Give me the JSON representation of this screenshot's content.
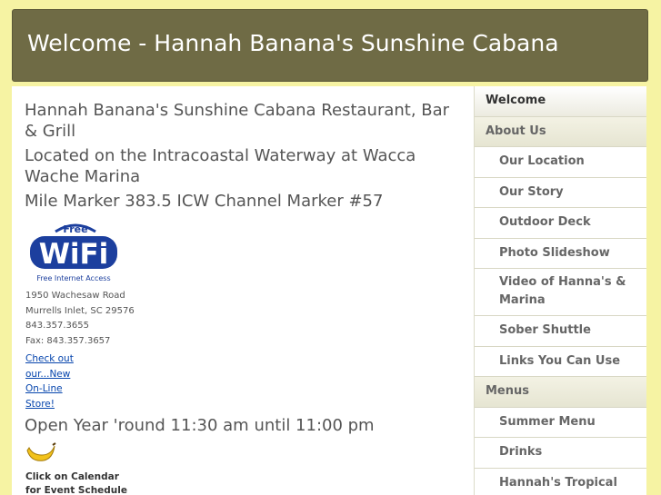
{
  "header": {
    "title": "Welcome - Hannah Banana's Sunshine Cabana"
  },
  "main": {
    "headline1": "Hannah Banana's Sunshine Cabana Restaurant, Bar & Grill",
    "headline2": "Located on the Intracoastal Waterway at Wacca Wache Marina",
    "headline3": "Mile Marker 383.5 ICW Channel Marker #57",
    "wifi": {
      "top": "Free",
      "main": "WiFi",
      "sub": "Free Internet Access"
    },
    "address": [
      "1950 Wachesaw Road",
      "Murrells Inlet, SC 29576",
      "843.357.3655",
      "Fax: 843.357.3657"
    ],
    "store_link": "Check out our...New On-Line Store!",
    "hours": "Open Year 'round 11:30 am until 11:00 pm",
    "calendar_note": "Click on Calendar for Event Schedule"
  },
  "nav": {
    "items": [
      {
        "label": "Welcome",
        "level": "top",
        "active": true
      },
      {
        "label": "About Us",
        "level": "top"
      },
      {
        "label": "Our Location",
        "level": "sub"
      },
      {
        "label": "Our Story",
        "level": "sub"
      },
      {
        "label": "Outdoor Deck",
        "level": "sub"
      },
      {
        "label": "Photo Slideshow",
        "level": "sub"
      },
      {
        "label": "Video of Hanna's & Marina",
        "level": "sub"
      },
      {
        "label": "Sober Shuttle",
        "level": "sub"
      },
      {
        "label": "Links You Can Use",
        "level": "sub"
      },
      {
        "label": "Menus",
        "level": "top"
      },
      {
        "label": "Summer Menu",
        "level": "sub"
      },
      {
        "label": "Drinks",
        "level": "sub"
      },
      {
        "label": "Hannah's Tropical",
        "level": "sub"
      }
    ]
  },
  "colors": {
    "background": "#f6f3a3",
    "header": "#6f6b45",
    "link": "#0645ad",
    "wifi_blue": "#1c3f9e"
  }
}
